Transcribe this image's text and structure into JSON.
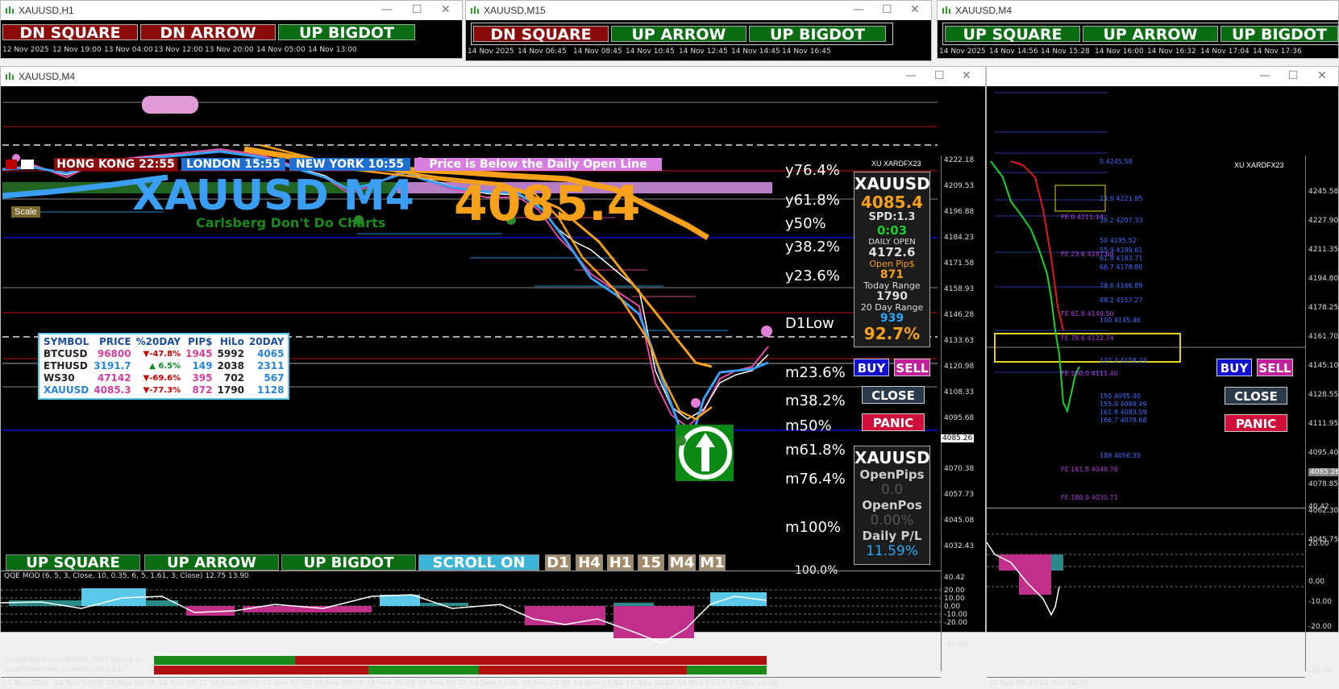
{
  "windows": {
    "h1": {
      "title": "XAUUSD,H1",
      "signals": [
        "DN SQUARE",
        "DN ARROW",
        "UP BIGDOT"
      ],
      "times": [
        "12 Nov 2025",
        "12 Nov 19:00",
        "13 Nov 04:00",
        "13 Nov 12:00",
        "13 Nov 20:00",
        "14 Nov 05:00",
        "14 Nov 13:00"
      ]
    },
    "m15": {
      "title": "XAUUSD,M15",
      "signals": [
        "DN SQUARE",
        "UP ARROW",
        "UP BIGDOT"
      ],
      "times": [
        "14 Nov 2025",
        "14 Nov 06:45",
        "14 Nov 08:45",
        "14 Nov 10:45",
        "14 Nov 12:45",
        "14 Nov 14:45",
        "14 Nov 16:45"
      ]
    },
    "m4top": {
      "title": "XAUUSD,M4",
      "signals": [
        "UP SQUARE",
        "UP ARROW",
        "UP BIGDOT"
      ],
      "times": [
        "14 Nov 2025",
        "14 Nov 14:56",
        "14 Nov 15:28",
        "14 Nov 16:00",
        "14 Nov 16:32",
        "14 Nov 17:04",
        "14 Nov 17:36"
      ]
    }
  },
  "main": {
    "title": "XAUUSD,M4",
    "sessions": [
      {
        "label": "HONG KONG 22:55",
        "color": "#8b0b0b"
      },
      {
        "label": "LONDON  15:55",
        "color": "#1e6fcf"
      },
      {
        "label": "NEW YORK  10:55",
        "color": "#1e6fcf"
      },
      {
        "label": "Price is Below the Daily Open Line",
        "color": "#d77fe0"
      }
    ],
    "symbol_title": "XAUUSD M4",
    "price_big": "4085.4",
    "subtitle": "Carlsberg Don't Do Charts",
    "scale_label": "Scale",
    "broker": "XU XARDFX23",
    "fib_labels": [
      "y76.4%",
      "y61.8%",
      "y50%",
      "y38.2%",
      "y23.6%",
      "D1Low",
      "m23.6%",
      "m38.2%",
      "m50%",
      "m61.8%",
      "m76.4%",
      "m100%"
    ],
    "price_axis": [
      "4222.18",
      "4209.53",
      "4196.88",
      "4184.23",
      "4171.58",
      "4158.93",
      "4146.28",
      "4133.63",
      "4120.98",
      "4108.33",
      "4095.68",
      "4085.26",
      "4070.38",
      "4057.73",
      "4045.08",
      "4032.43"
    ],
    "price_marker": "4085.26",
    "time_axis": [
      "14 Nov 2025",
      "14 Nov 03:04",
      "14 Nov 04:08",
      "14 Nov 05:12",
      "14 Nov 06:16",
      "14 Nov 07:20",
      "14 Nov 08:24",
      "14 Nov 09:28",
      "14 Nov 10:32",
      "14 Nov 11:36",
      "14 Nov 12:40",
      "14 Nov 13:44",
      "14 Nov 14:48",
      "14 Nov 15:52",
      "14 Nov 16:56"
    ],
    "info": {
      "symbol": "XAUUSD",
      "price": "4085.4",
      "spread": "SPD:1.3",
      "timer": "0:03",
      "daily_open_label": "DAILY OPEN",
      "daily_open": "4172.6",
      "open_pips_label": "Open Pip$",
      "open_pips": "871",
      "today_range_label": "Today Range",
      "today_range": "1790",
      "day20_label": "20 Day Range",
      "day20": "939",
      "percent": "92.7%"
    },
    "trade": {
      "buy": "BUY",
      "sell": "SELL",
      "close": "CLOSE",
      "panic": "PANIC"
    },
    "pos": {
      "symbol": "XAUUSD",
      "open_pips_label": "OpenPips",
      "open_pips": "0.0",
      "open_pos_label": "OpenPos",
      "open_pos": "0.00%",
      "daily_pl_label": "Daily P/L",
      "daily_pl": "11.59%"
    },
    "table": {
      "headers": [
        "SYMBOL",
        "PRICE",
        "%20DAY",
        "PIP$",
        "HiLo",
        "20DAY"
      ],
      "rows": [
        {
          "sym": "BTCUSD",
          "price": "96800",
          "pct": "▼-47.8%",
          "pips": "1945",
          "hilo": "5992",
          "day": "4065",
          "sc": "#222",
          "pc": "#d0409a",
          "pctc": "#c00000"
        },
        {
          "sym": "ETHUSD",
          "price": "3191.7",
          "pct": "▲ 6.5%",
          "pips": "149",
          "hilo": "2038",
          "day": "2311",
          "sc": "#222",
          "pc": "#2a84d8",
          "pctc": "#0a8a20"
        },
        {
          "sym": "WS30",
          "price": "47142",
          "pct": "▼-69.6%",
          "pips": "395",
          "hilo": "702",
          "day": "567",
          "sc": "#222",
          "pc": "#d0409a",
          "pctc": "#c00000"
        },
        {
          "sym": "XAUUSD",
          "price": "4085.3",
          "pct": "▼-77.3%",
          "pips": "872",
          "hilo": "1790",
          "day": "1128",
          "sc": "#2a84d8",
          "pc": "#d0409a",
          "pctc": "#c00000"
        }
      ]
    },
    "bottom_buttons": [
      "UP SQUARE",
      "UP ARROW",
      "UP BIGDOT",
      "SCROLL ON"
    ],
    "tf_buttons": [
      "D1",
      "H4",
      "H1",
      "15",
      "M4",
      "M1"
    ],
    "qqe_label": "QQE MOD (6, 5, 3, Close, 10, 0.35, 6, 5, 1.61, 3, Close) 12.75 13.90",
    "qqe_axis": [
      "40.42",
      "20.00",
      "10.00",
      "0.00",
      "-10.00",
      "-20.00",
      "-40.00"
    ],
    "st1_label": "SuperTrend Histo [PERIOD_M15] (10,3,0,1)",
    "st2_label": "SuperTrend Histo [Current] (10,3,0,1)",
    "partial_label": "100.0%"
  },
  "right": {
    "broker": "XU XARDFX23",
    "price_axis": [
      "4245.58",
      "4227.90",
      "4211.35",
      "4194.80",
      "4178.25",
      "4161.70",
      "4145.10",
      "4128.55",
      "4111.95",
      "4095.40",
      "4085.26",
      "4078.85",
      "4062.30",
      "4045.75"
    ],
    "fibs": [
      {
        "t": "0  4245.58",
        "c": "#3f6dff"
      },
      {
        "t": "23.6  4221.95",
        "c": "#3f6dff"
      },
      {
        "t": "FE 0  4211.14",
        "c": "#b040e0"
      },
      {
        "t": "38.2  4207.33",
        "c": "#3f6dff"
      },
      {
        "t": "50  4195.52",
        "c": "#3f6dff"
      },
      {
        "t": "FE 23.6  4187.60",
        "c": "#b040e0"
      },
      {
        "t": "55.9  4189.61",
        "c": "#3f6dff"
      },
      {
        "t": "61.8  4183.71",
        "c": "#3f6dff"
      },
      {
        "t": "66.7  4178.80",
        "c": "#3f6dff"
      },
      {
        "t": "78.6  4166.89",
        "c": "#3f6dff"
      },
      {
        "t": "88.2  4157.27",
        "c": "#3f6dff"
      },
      {
        "t": "FE 61.8  4149.50",
        "c": "#b040e0"
      },
      {
        "t": "100  4145.46",
        "c": "#3f6dff"
      },
      {
        "t": "FE 78.6  4132.74",
        "c": "#b040e0"
      },
      {
        "t": "127.2  4118.23",
        "c": "#3f6dff"
      },
      {
        "t": "FE 100.0  4111.40",
        "c": "#b040e0"
      },
      {
        "t": "150  4095.40",
        "c": "#3f6dff"
      },
      {
        "t": "155.9  4089.49",
        "c": "#3f6dff"
      },
      {
        "t": "161.8  4083.59",
        "c": "#3f6dff"
      },
      {
        "t": "166.7  4078.68",
        "c": "#3f6dff"
      },
      {
        "t": "189  4056.35",
        "c": "#3f6dff"
      },
      {
        "t": "FE 161.8  4049.76",
        "c": "#b040e0"
      },
      {
        "t": "FE 180.9  4030.71",
        "c": "#b040e0"
      }
    ],
    "price_marker": "4085.26",
    "times": [
      "14 Nov 06:30",
      "14 Nov 14:30"
    ],
    "qqe_axis": [
      "40.42",
      "20.00",
      "0.00",
      "-10.00",
      "-20.00",
      "-46.40"
    ],
    "trade": {
      "buy": "BUY",
      "sell": "SELL",
      "close": "CLOSE",
      "panic": "PANIC"
    }
  },
  "colors": {
    "accent_orange": "#f7a01a",
    "blue_ma": "#3a9ef5",
    "pink": "#e04ca8",
    "green_btn": "#0a6d13",
    "red_btn": "#8b0b0b"
  }
}
